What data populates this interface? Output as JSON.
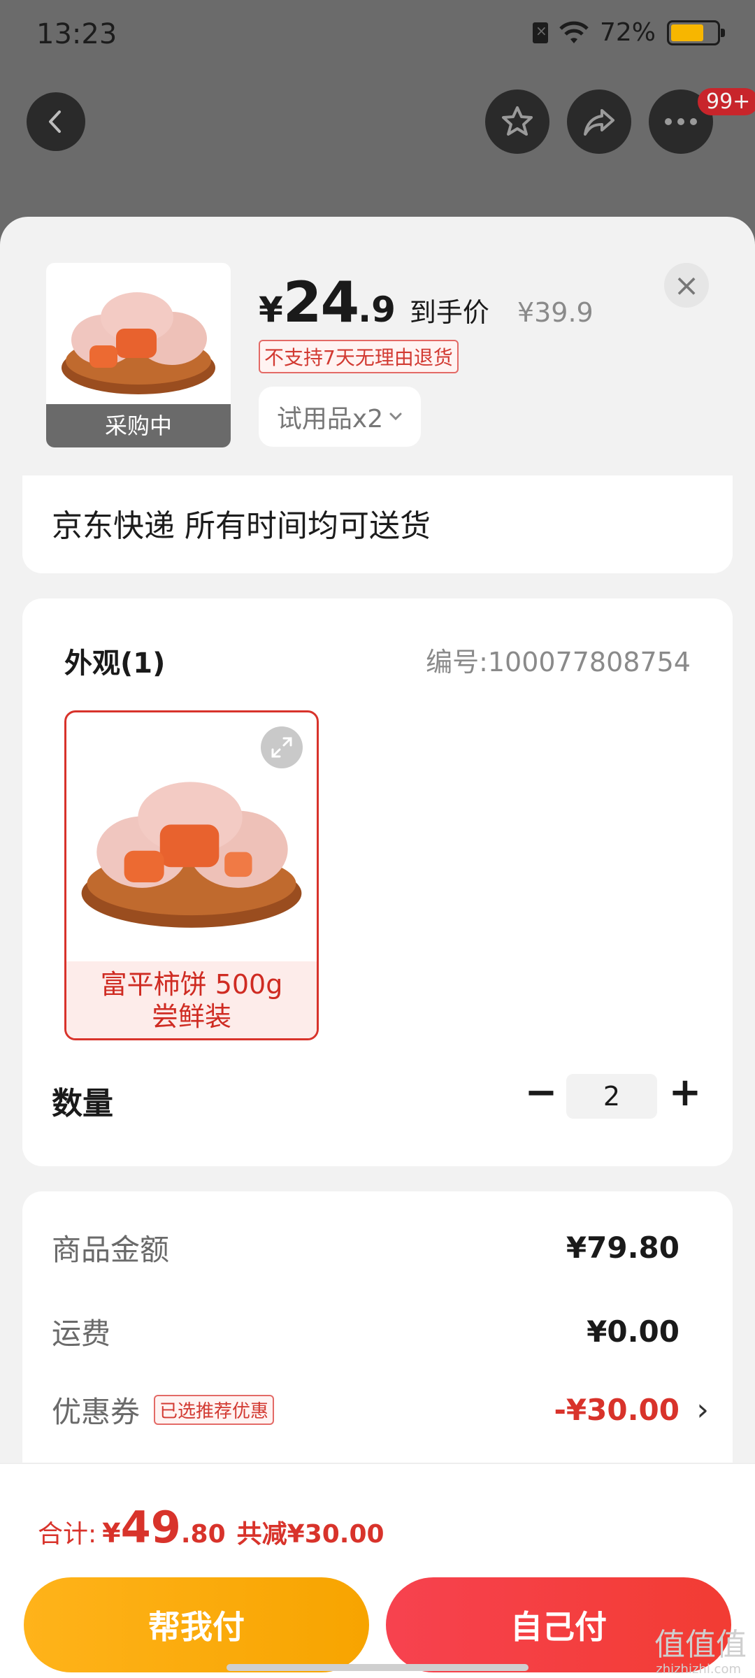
{
  "status_bar": {
    "time": "13:23",
    "battery": "72%"
  },
  "nav": {
    "badge": "99+"
  },
  "product": {
    "price_symbol": "¥",
    "price_int": "24",
    "price_dec": ".9",
    "price_tag": "到手价",
    "original_price": "¥39.9",
    "no_return_label": "不支持7天无理由退货",
    "thumb_label": "采购中",
    "trial_label": "试用品x2",
    "close_symbol": "×"
  },
  "delivery": {
    "text": "京东快递 所有时间均可送货"
  },
  "options": {
    "appearance_title": "外观(1)",
    "sku_number": "编号:100077808754",
    "variant_label_line1": "富平柿饼 500g",
    "variant_label_line2": "尝鲜装"
  },
  "quantity": {
    "label": "数量",
    "value": "2",
    "minus": "−",
    "plus": "+"
  },
  "summary": {
    "goods_label": "商品金额",
    "goods_value": "¥79.80",
    "shipping_label": "运费",
    "shipping_value": "¥0.00",
    "coupon_label": "优惠券",
    "coupon_badge": "已选推荐优惠",
    "coupon_value": "-¥30.00",
    "chevron": "›"
  },
  "footer": {
    "total_prefix": "合计:",
    "total_symbol": "¥",
    "total_int": "49",
    "total_dec": ".80",
    "total_reduce": "共减¥30.00",
    "help_pay_label": "帮我付",
    "self_pay_label": "自己付"
  },
  "watermark": {
    "text": "值值值",
    "sub": "zhizhizhi.com"
  },
  "colors": {
    "accent_red": "#d8332b",
    "help_pay": "#f7a400",
    "self_pay": "#f23c33"
  }
}
